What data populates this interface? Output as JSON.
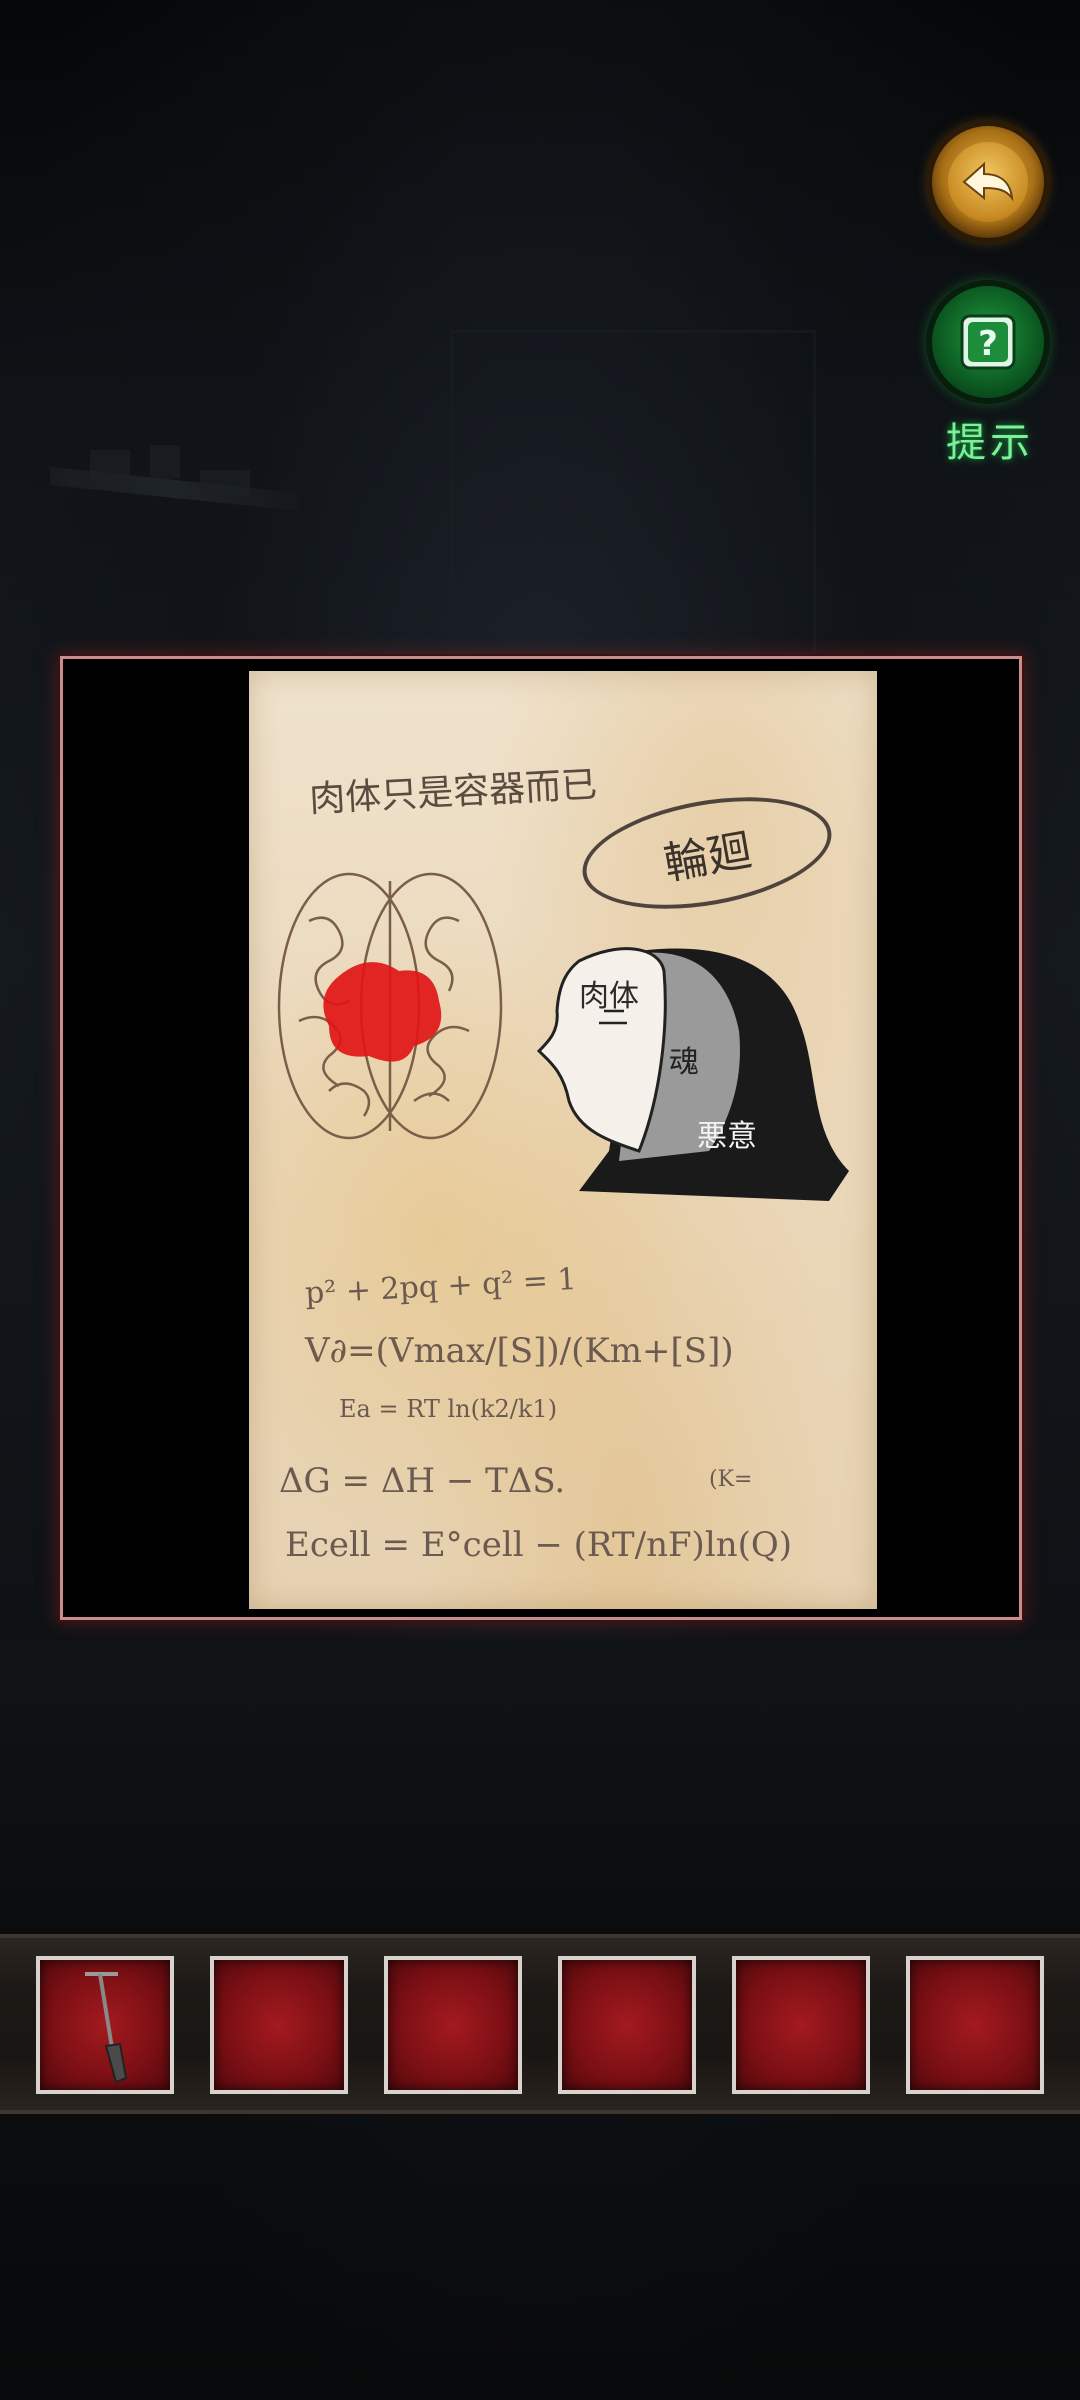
{
  "hud": {
    "back_icon": "back-arrow-icon",
    "hint_icon": "hint-question-icon",
    "hint_label": "提示"
  },
  "note": {
    "title": "肉体只是容器而已",
    "circled_word": "輪廻",
    "diagram_labels": {
      "flesh": "肉体",
      "soul": "魂",
      "evil": "悪意"
    },
    "equations": [
      "p² + 2pq + q² = 1",
      "V∂=(Vmax/[S])/(Km+[S])",
      "Ea = RT ln(k2/k1)",
      "ΔG = ΔH − TΔS.",
      "(K=",
      "Ecell = E°cell − (RT/nF)ln(Q)"
    ]
  },
  "inventory": {
    "slots": [
      {
        "item": "shovel-icon"
      },
      {
        "item": ""
      },
      {
        "item": ""
      },
      {
        "item": ""
      },
      {
        "item": ""
      },
      {
        "item": ""
      }
    ]
  },
  "colors": {
    "hint_green": "#7ef09a",
    "slot_red": "#8c1419",
    "frame_border": "#c98d8d",
    "brain_blood": "#e01616"
  }
}
